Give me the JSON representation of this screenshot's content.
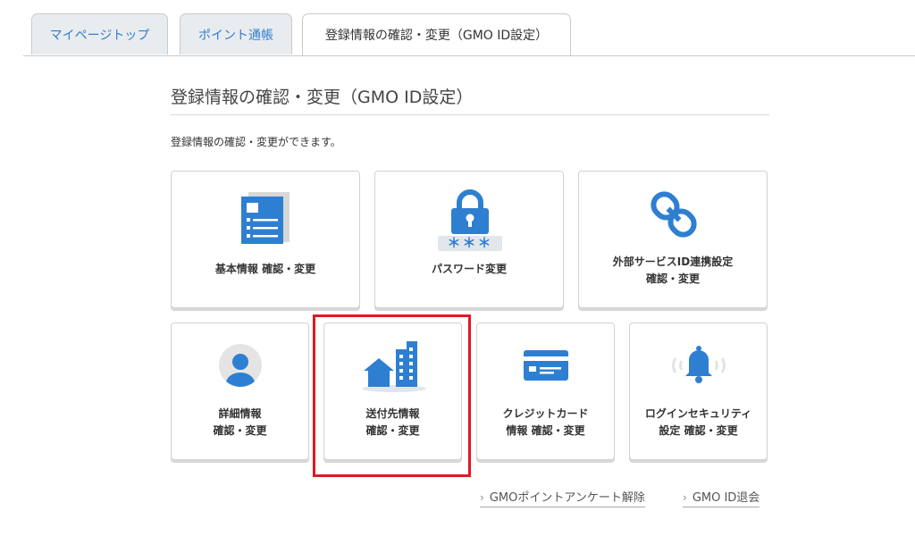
{
  "tabs": [
    {
      "label": "マイページトップ"
    },
    {
      "label": "ポイント通帳"
    },
    {
      "label": "登録情報の確認・変更（GMO ID設定）"
    }
  ],
  "page": {
    "title": "登録情報の確認・変更（GMO ID設定）",
    "description": "登録情報の確認・変更ができます。"
  },
  "cards": [
    {
      "line1": "基本情報 確認・変更",
      "line2": ""
    },
    {
      "line1": "パスワード変更",
      "line2": "",
      "mask": "＊＊＊"
    },
    {
      "line1": "外部サービスID連携設定",
      "line2": "確認・変更"
    },
    {
      "line1": "詳細情報",
      "line2": "確認・変更"
    },
    {
      "line1": "送付先情報",
      "line2": "確認・変更"
    },
    {
      "line1": "クレジットカード",
      "line2": "情報 確認・変更"
    },
    {
      "line1": "ログインセキュリティ",
      "line2": "設定 確認・変更"
    }
  ],
  "links": [
    {
      "chevron": "›",
      "label": "GMOポイントアンケート解除"
    },
    {
      "chevron": "›",
      "label": "GMO ID退会"
    }
  ],
  "colors": {
    "accent": "#2f7fd0",
    "icon_blue": "#2e7fd1",
    "highlight": "#e01a22"
  },
  "icons": [
    "document-icon",
    "lock-icon",
    "chain-link-icon",
    "user-icon",
    "home-building-icon",
    "credit-card-icon",
    "bell-icon"
  ]
}
